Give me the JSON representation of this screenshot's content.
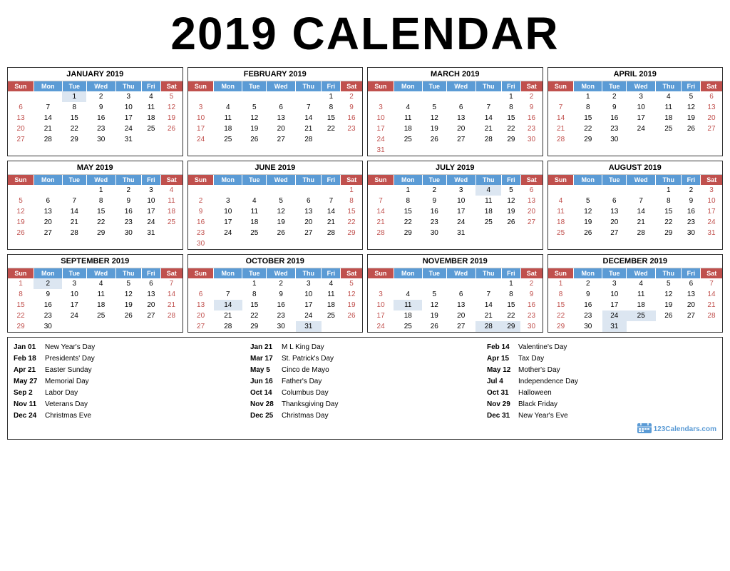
{
  "title": "2019 CALENDAR",
  "months": [
    {
      "name": "JANUARY 2019",
      "weeks": [
        [
          "",
          "",
          "1",
          "2",
          "3",
          "4",
          "5"
        ],
        [
          "6",
          "7",
          "8",
          "9",
          "10",
          "11",
          "12"
        ],
        [
          "13",
          "14",
          "15",
          "16",
          "17",
          "18",
          "19"
        ],
        [
          "20",
          "21",
          "22",
          "23",
          "24",
          "25",
          "26"
        ],
        [
          "27",
          "28",
          "29",
          "30",
          "31",
          "",
          ""
        ]
      ]
    },
    {
      "name": "FEBRUARY 2019",
      "weeks": [
        [
          "",
          "",
          "",
          "",
          "",
          "1",
          "2"
        ],
        [
          "3",
          "4",
          "5",
          "6",
          "7",
          "8",
          "9"
        ],
        [
          "10",
          "11",
          "12",
          "13",
          "14",
          "15",
          "16"
        ],
        [
          "17",
          "18",
          "19",
          "20",
          "21",
          "22",
          "23"
        ],
        [
          "24",
          "25",
          "26",
          "27",
          "28",
          "",
          ""
        ]
      ]
    },
    {
      "name": "MARCH 2019",
      "weeks": [
        [
          "",
          "",
          "",
          "",
          "",
          "1",
          "2"
        ],
        [
          "3",
          "4",
          "5",
          "6",
          "7",
          "8",
          "9"
        ],
        [
          "10",
          "11",
          "12",
          "13",
          "14",
          "15",
          "16"
        ],
        [
          "17",
          "18",
          "19",
          "20",
          "21",
          "22",
          "23"
        ],
        [
          "24",
          "25",
          "26",
          "27",
          "28",
          "29",
          "30"
        ],
        [
          "31",
          "",
          "",
          "",
          "",
          "",
          ""
        ]
      ]
    },
    {
      "name": "APRIL 2019",
      "weeks": [
        [
          "",
          "1",
          "2",
          "3",
          "4",
          "5",
          "6"
        ],
        [
          "7",
          "8",
          "9",
          "10",
          "11",
          "12",
          "13"
        ],
        [
          "14",
          "15",
          "16",
          "17",
          "18",
          "19",
          "20"
        ],
        [
          "21",
          "22",
          "23",
          "24",
          "25",
          "26",
          "27"
        ],
        [
          "28",
          "29",
          "30",
          "",
          "",
          "",
          ""
        ]
      ]
    },
    {
      "name": "MAY 2019",
      "weeks": [
        [
          "",
          "",
          "",
          "1",
          "2",
          "3",
          "4"
        ],
        [
          "5",
          "6",
          "7",
          "8",
          "9",
          "10",
          "11"
        ],
        [
          "12",
          "13",
          "14",
          "15",
          "16",
          "17",
          "18"
        ],
        [
          "19",
          "20",
          "21",
          "22",
          "23",
          "24",
          "25"
        ],
        [
          "26",
          "27",
          "28",
          "29",
          "30",
          "31",
          ""
        ]
      ]
    },
    {
      "name": "JUNE 2019",
      "weeks": [
        [
          "",
          "",
          "",
          "",
          "",
          "",
          "1"
        ],
        [
          "2",
          "3",
          "4",
          "5",
          "6",
          "7",
          "8"
        ],
        [
          "9",
          "10",
          "11",
          "12",
          "13",
          "14",
          "15"
        ],
        [
          "16",
          "17",
          "18",
          "19",
          "20",
          "21",
          "22"
        ],
        [
          "23",
          "24",
          "25",
          "26",
          "27",
          "28",
          "29"
        ],
        [
          "30",
          "",
          "",
          "",
          "",
          "",
          ""
        ]
      ]
    },
    {
      "name": "JULY 2019",
      "weeks": [
        [
          "",
          "1",
          "2",
          "3",
          "4",
          "5",
          "6"
        ],
        [
          "7",
          "8",
          "9",
          "10",
          "11",
          "12",
          "13"
        ],
        [
          "14",
          "15",
          "16",
          "17",
          "18",
          "19",
          "20"
        ],
        [
          "21",
          "22",
          "23",
          "24",
          "25",
          "26",
          "27"
        ],
        [
          "28",
          "29",
          "30",
          "31",
          "",
          "",
          ""
        ]
      ]
    },
    {
      "name": "AUGUST 2019",
      "weeks": [
        [
          "",
          "",
          "",
          "",
          "1",
          "2",
          "3"
        ],
        [
          "4",
          "5",
          "6",
          "7",
          "8",
          "9",
          "10"
        ],
        [
          "11",
          "12",
          "13",
          "14",
          "15",
          "16",
          "17"
        ],
        [
          "18",
          "19",
          "20",
          "21",
          "22",
          "23",
          "24"
        ],
        [
          "25",
          "26",
          "27",
          "28",
          "29",
          "30",
          "31"
        ]
      ]
    },
    {
      "name": "SEPTEMBER 2019",
      "weeks": [
        [
          "1",
          "2",
          "3",
          "4",
          "5",
          "6",
          "7"
        ],
        [
          "8",
          "9",
          "10",
          "11",
          "12",
          "13",
          "14"
        ],
        [
          "15",
          "16",
          "17",
          "18",
          "19",
          "20",
          "21"
        ],
        [
          "22",
          "23",
          "24",
          "25",
          "26",
          "27",
          "28"
        ],
        [
          "29",
          "30",
          "",
          "",
          "",
          "",
          ""
        ]
      ]
    },
    {
      "name": "OCTOBER 2019",
      "weeks": [
        [
          "",
          "",
          "1",
          "2",
          "3",
          "4",
          "5"
        ],
        [
          "6",
          "7",
          "8",
          "9",
          "10",
          "11",
          "12"
        ],
        [
          "13",
          "14",
          "15",
          "16",
          "17",
          "18",
          "19"
        ],
        [
          "20",
          "21",
          "22",
          "23",
          "24",
          "25",
          "26"
        ],
        [
          "27",
          "28",
          "29",
          "30",
          "31",
          "",
          ""
        ]
      ]
    },
    {
      "name": "NOVEMBER 2019",
      "weeks": [
        [
          "",
          "",
          "",
          "",
          "",
          "1",
          "2"
        ],
        [
          "3",
          "4",
          "5",
          "6",
          "7",
          "8",
          "9"
        ],
        [
          "10",
          "11",
          "12",
          "13",
          "14",
          "15",
          "16"
        ],
        [
          "17",
          "18",
          "19",
          "20",
          "21",
          "22",
          "23"
        ],
        [
          "24",
          "25",
          "26",
          "27",
          "28",
          "29",
          "30"
        ]
      ]
    },
    {
      "name": "DECEMBER 2019",
      "weeks": [
        [
          "1",
          "2",
          "3",
          "4",
          "5",
          "6",
          "7"
        ],
        [
          "8",
          "9",
          "10",
          "11",
          "12",
          "13",
          "14"
        ],
        [
          "15",
          "16",
          "17",
          "18",
          "19",
          "20",
          "21"
        ],
        [
          "22",
          "23",
          "24",
          "25",
          "26",
          "27",
          "28"
        ],
        [
          "29",
          "30",
          "31",
          "",
          "",
          "",
          ""
        ]
      ]
    }
  ],
  "days_header": [
    "Sun",
    "Mon",
    "Tue",
    "Wed",
    "Thu",
    "Fri",
    "Sat"
  ],
  "holidays_col1": [
    {
      "date": "Jan 01",
      "name": "New Year's Day"
    },
    {
      "date": "Feb 18",
      "name": "Presidents' Day"
    },
    {
      "date": "Apr 21",
      "name": "Easter Sunday"
    },
    {
      "date": "May 27",
      "name": "Memorial Day"
    },
    {
      "date": "Sep 2",
      "name": "Labor Day"
    },
    {
      "date": "Nov 11",
      "name": "Veterans Day"
    },
    {
      "date": "Dec 24",
      "name": "Christmas Eve"
    }
  ],
  "holidays_col2": [
    {
      "date": "Jan 21",
      "name": "M L King Day"
    },
    {
      "date": "Mar 17",
      "name": "St. Patrick's Day"
    },
    {
      "date": "May 5",
      "name": "Cinco de Mayo"
    },
    {
      "date": "Jun 16",
      "name": "Father's Day"
    },
    {
      "date": "Oct 14",
      "name": "Columbus Day"
    },
    {
      "date": "Nov 28",
      "name": "Thanksgiving Day"
    },
    {
      "date": "Dec 25",
      "name": "Christmas Day"
    }
  ],
  "holidays_col3": [
    {
      "date": "Feb 14",
      "name": "Valentine's Day"
    },
    {
      "date": "Apr 15",
      "name": "Tax Day"
    },
    {
      "date": "May 12",
      "name": "Mother's Day"
    },
    {
      "date": "Jul 4",
      "name": "Independence Day"
    },
    {
      "date": "Oct 31",
      "name": "Halloween"
    },
    {
      "date": "Nov 29",
      "name": "Black Friday"
    },
    {
      "date": "Dec 31",
      "name": "New Year's Eve"
    }
  ],
  "logo_text": "123Calendars.com"
}
